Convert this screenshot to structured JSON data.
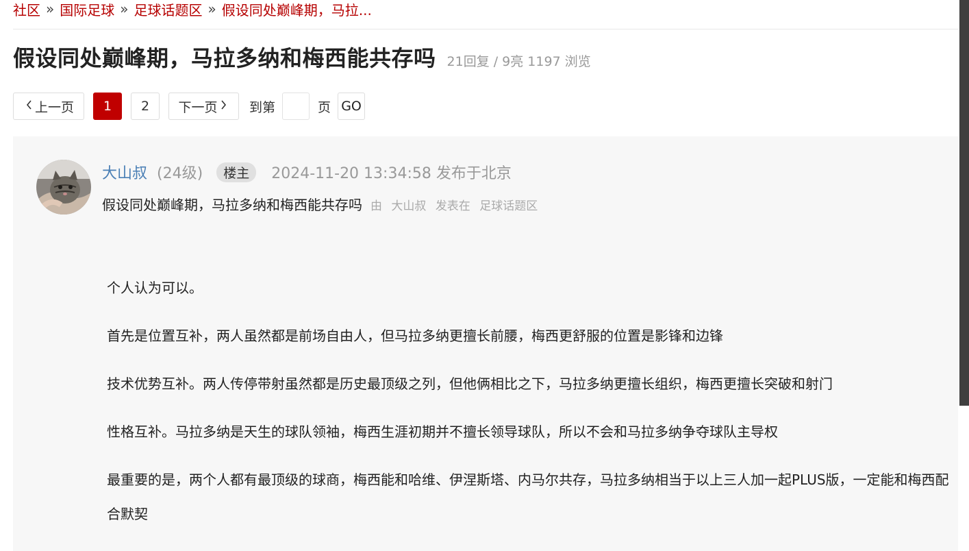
{
  "breadcrumb": {
    "items": [
      "社区",
      "国际足球",
      "足球话题区",
      "假设同处巅峰期，马拉..."
    ],
    "separator": "»"
  },
  "thread": {
    "title": "假设同处巅峰期，马拉多纳和梅西能共存吗",
    "stats": "21回复 / 9亮 1197 浏览"
  },
  "pager": {
    "prev_label": "上一页",
    "pages": [
      "1",
      "2"
    ],
    "current_page": "1",
    "next_label": "下一页",
    "goto_label": "到第",
    "page_suffix": "页",
    "go_label": "GO",
    "page_input_value": ""
  },
  "post": {
    "username": "大山叔",
    "level": "(24级)",
    "badge": "楼主",
    "timestamp": "2024-11-20 13:34:58 发布于北京",
    "title": "假设同处巅峰期，马拉多纳和梅西能共存吗",
    "by_label": "由",
    "author": "大山叔",
    "posted_in_label": "发表在",
    "forum": "足球话题区",
    "paragraphs": [
      "个人认为可以。",
      "首先是位置互补，两人虽然都是前场自由人，但马拉多纳更擅长前腰，梅西更舒服的位置是影锋和边锋",
      "技术优势互补。两人传停带射虽然都是历史最顶级之列，但他俩相比之下，马拉多纳更擅长组织，梅西更擅长突破和射门",
      "性格互补。马拉多纳是天生的球队领袖，梅西生涯初期并不擅长领导球队，所以不会和马拉多纳争夺球队主导权",
      "最重要的是，两个人都有最顶级的球商，梅西能和哈维、伊涅斯塔、内马尔共存，马拉多纳相当于以上三人加一起PLUS版，一定能和梅西配合默契"
    ]
  },
  "colors": {
    "brand_red": "#b60000",
    "active_page": "#c00000",
    "username_blue": "#4a7fb5",
    "post_bg": "#f7f7f7"
  }
}
